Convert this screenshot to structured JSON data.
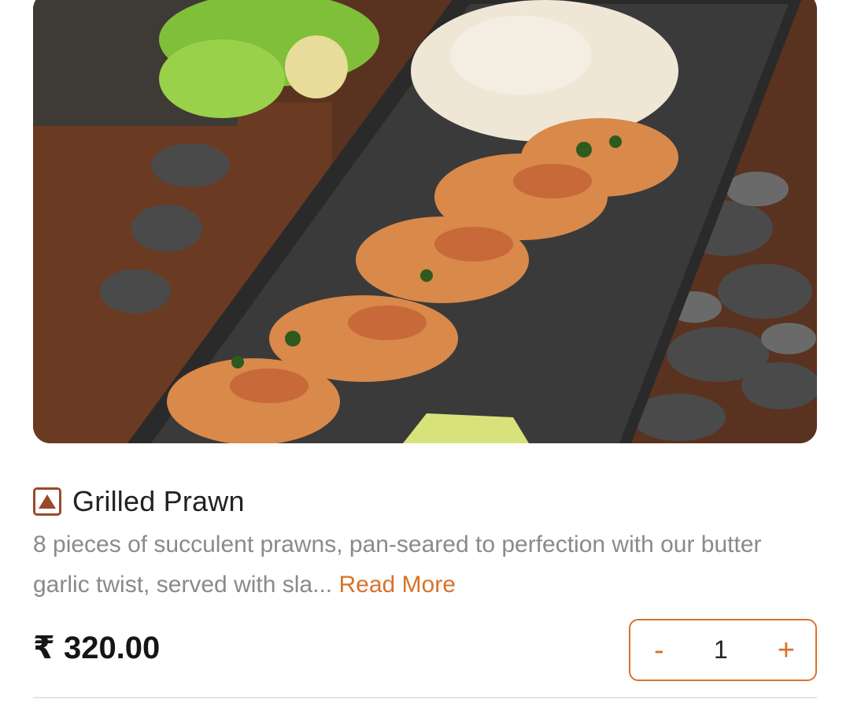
{
  "item": {
    "image_alt": "Grilled prawns on a black slate with coleslaw and lime",
    "name": "Grilled Prawn",
    "diet_icon": "non-veg-triangle-icon",
    "description_text": "8 pieces of succulent prawns, pan-seared to perfection with our butter garlic twist, served with sla...",
    "read_more_label": "Read More",
    "price": "₹ 320.00"
  },
  "stepper": {
    "minus_label": "-",
    "quantity": "1",
    "plus_label": "+"
  },
  "colors": {
    "accent": "#d9722b",
    "non_veg": "#9a4a2a",
    "text": "#222222",
    "muted": "#8a8a8a"
  }
}
